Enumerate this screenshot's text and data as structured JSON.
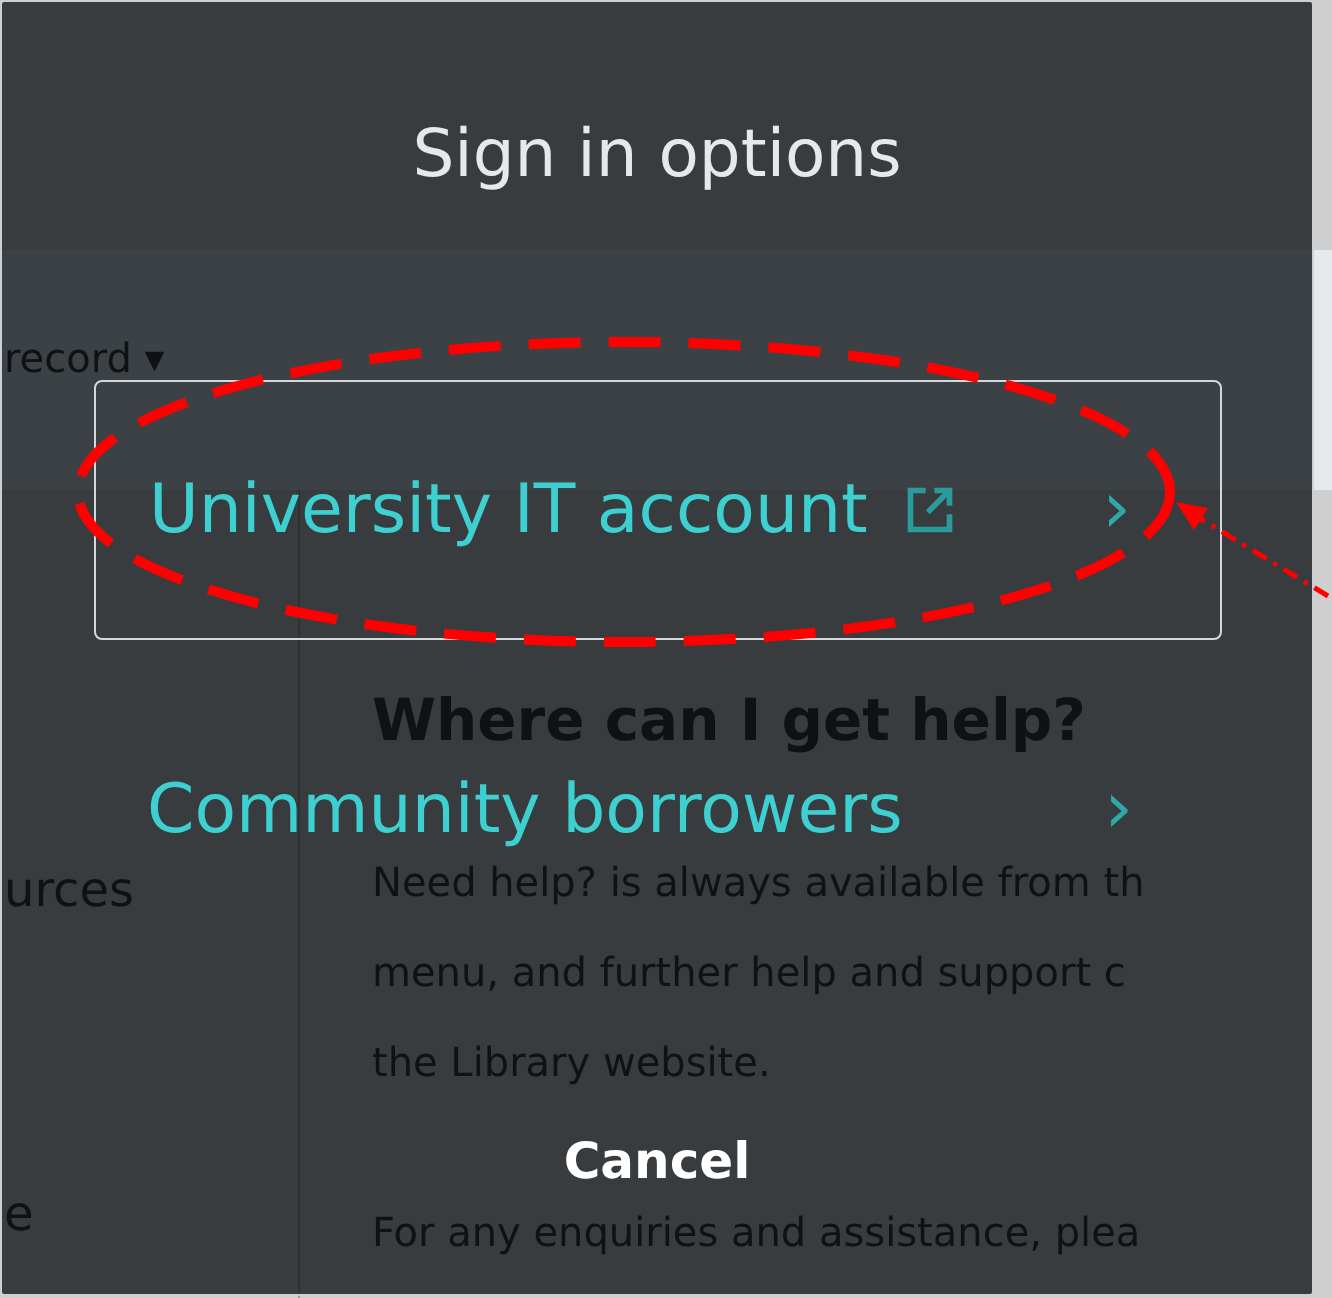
{
  "background_page": {
    "record_menu": {
      "label": "record",
      "caret": "▾"
    },
    "sidebar": [
      "urces",
      "e"
    ],
    "heading": "Where can I get help?",
    "paragraphs": [
      {
        "lines": [
          "Need help? is always available from th",
          "menu, and further help and support c",
          "the Library website."
        ]
      },
      {
        "lines": [
          "For any enquiries and assistance, plea"
        ]
      }
    ]
  },
  "dialog": {
    "title": "Sign in options",
    "options": [
      {
        "label": "University IT account",
        "external": true,
        "selected": true,
        "chevron": "›"
      },
      {
        "label": "Community borrowers",
        "external": false,
        "selected": false,
        "chevron": "›"
      }
    ],
    "cancel": "Cancel"
  }
}
